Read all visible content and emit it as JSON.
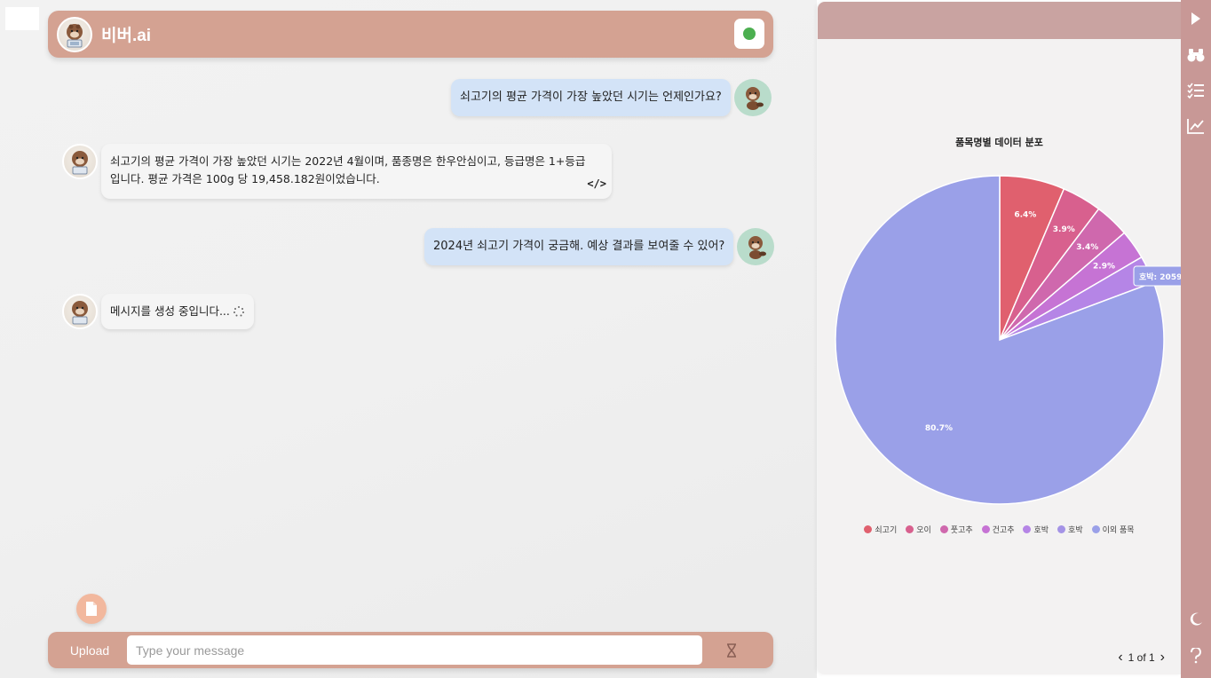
{
  "app": {
    "title": "비버.ai"
  },
  "messages": [
    {
      "role": "user",
      "text": "쇠고기의 평균 가격이 가장 높았던 시기는 언제인가요?"
    },
    {
      "role": "bot",
      "line1": "쇠고기의 평균 가격이 가장 높았던 시기는 2022년 4월이며, 품종명은 한우안심이고, 등급명은 1+등급",
      "line2": "입니다. 평균 가격은 100g 당 19,458.182원이었습니다.",
      "code_icon": "</>"
    },
    {
      "role": "user",
      "text": "2024년 쇠고기 가격이 궁금해. 예상 결과를 보여줄 수 있어?"
    },
    {
      "role": "bot",
      "text": "메시지를 생성 중입니다..."
    }
  ],
  "composer": {
    "upload_label": "Upload",
    "placeholder": "Type your message"
  },
  "colors": {
    "header": "#d4a292",
    "rail": "#c89896",
    "user_bubble": "#d3e3f7",
    "status": "#4caf50"
  },
  "chart_panel": {
    "pager_text": "1 of 1",
    "tooltip": "호박:  2059"
  },
  "chart_data": {
    "type": "pie",
    "title": "품목명별 데이터 분포",
    "slices": [
      {
        "label": "쇠고기",
        "value": 6.4,
        "color": "#e0606e",
        "data_label": "6.4%"
      },
      {
        "label": "오이",
        "value": 3.9,
        "color": "#d8608e",
        "data_label": "3.9%"
      },
      {
        "label": "풋고추",
        "value": 3.4,
        "color": "#cf68ad",
        "data_label": "3.4%"
      },
      {
        "label": "건고추",
        "value": 2.9,
        "color": "#c673d4",
        "data_label": "2.9%"
      },
      {
        "label": "호박",
        "value": 2.7,
        "color": "#b585e6",
        "data_label": ""
      },
      {
        "label": "호박",
        "value": 0.0,
        "color": "#a493e6",
        "data_label": ""
      },
      {
        "label": "이외 품목",
        "value": 80.7,
        "color": "#9aa0e8",
        "data_label": "80.7%"
      }
    ],
    "legend_position": "bottom"
  },
  "icons": {
    "sidebar": [
      "play-icon",
      "binoculars-icon",
      "checklist-icon",
      "line-chart-icon",
      "moon-icon",
      "help-icon"
    ]
  }
}
